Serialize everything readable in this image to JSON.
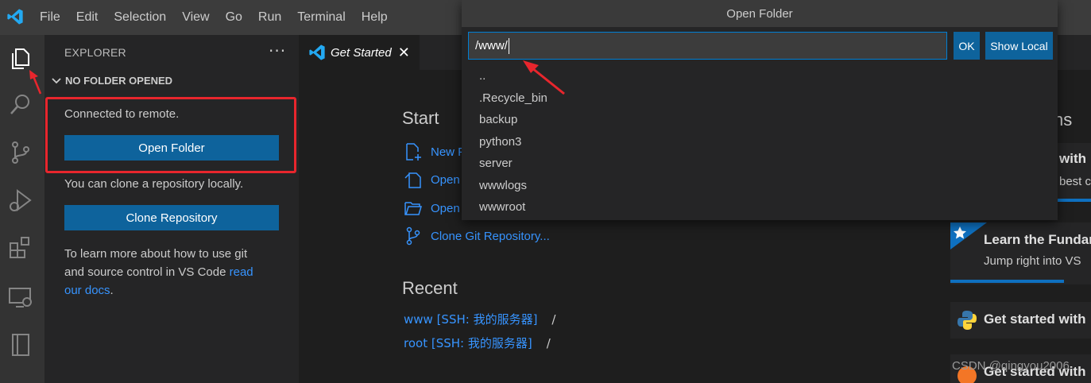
{
  "menu": [
    "File",
    "Edit",
    "Selection",
    "View",
    "Go",
    "Run",
    "Terminal",
    "Help"
  ],
  "sidebar": {
    "title": "EXPLORER",
    "more": "···",
    "section": "NO FOLDER OPENED",
    "connected_text": "Connected to remote.",
    "open_folder_label": "Open Folder",
    "clone_text": "You can clone a repository locally.",
    "clone_label": "Clone Repository",
    "learn_text_1": "To learn more about how to use git",
    "learn_text_2": "and source control in VS Code ",
    "learn_link_1": "read",
    "learn_link_2": "our docs",
    "learn_period": "."
  },
  "tab": {
    "label": "Get Started",
    "close": "✕"
  },
  "editor": {
    "start_heading": "Start",
    "start_items": [
      "New F",
      "Open",
      "Open",
      "Clone Git Repository..."
    ],
    "recent_heading": "Recent",
    "recent": [
      {
        "name": "www [SSH: 我的服务器]",
        "path": "/"
      },
      {
        "name": "root [SSH: 我的服务器]",
        "path": "/"
      }
    ],
    "walkthroughs_heading_fragment": "ns",
    "walkthroughs": [
      {
        "title": "with",
        "desc": "best c"
      },
      {
        "title": "Learn the Fundar",
        "desc": "Jump right into VS"
      },
      {
        "title": "Get started with"
      },
      {
        "title": "Get started with"
      }
    ]
  },
  "quickpick": {
    "title": "Open Folder",
    "input_value": "/www/",
    "ok_label": "OK",
    "show_local_label": "Show Local",
    "items": [
      "..",
      ".Recycle_bin",
      "backup",
      "python3",
      "server",
      "wwwlogs",
      "wwwroot"
    ]
  },
  "watermark": "CSDN @qingyou2006",
  "colors": {
    "accent": "#0e639c",
    "link": "#3794ff",
    "annotation": "#e8262d"
  }
}
